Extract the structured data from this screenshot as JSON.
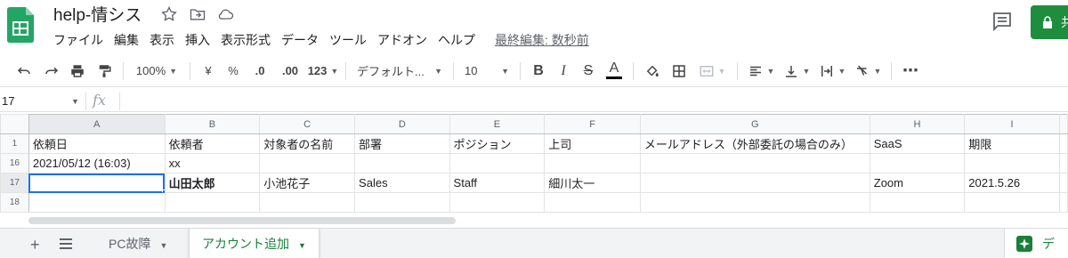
{
  "header": {
    "title": "help-情シス",
    "menu": [
      "ファイル",
      "編集",
      "表示",
      "挿入",
      "表示形式",
      "データ",
      "ツール",
      "アドオン",
      "ヘルプ"
    ],
    "last_edit": "最終編集: 数秒前",
    "share_label": "共"
  },
  "toolbar": {
    "zoom": "100%",
    "currency": "¥",
    "percent": "%",
    "decimal_dec": ".0",
    "decimal_inc": ".00",
    "format_more": "123",
    "font": "デフォルト...",
    "font_size": "10",
    "bold": "B",
    "italic": "I",
    "strike": "S",
    "text_color": "A",
    "more": "⋯"
  },
  "formula_bar": {
    "name_box": "17",
    "fx": "fx"
  },
  "grid": {
    "columns": [
      "A",
      "B",
      "C",
      "D",
      "E",
      "F",
      "G",
      "H",
      "I"
    ],
    "rows": [
      {
        "num": "1",
        "cells": [
          "依頼日",
          "依頼者",
          "対象者の名前",
          "部署",
          "ポジション",
          "上司",
          "メールアドレス（外部委託の場合のみ）",
          "SaaS",
          "期限"
        ]
      },
      {
        "num": "16",
        "cells": [
          "2021/05/12 (16:03)",
          "xx",
          "",
          "",
          "",
          "",
          "",
          "",
          ""
        ]
      },
      {
        "num": "17",
        "cells": [
          "",
          "山田太郎",
          "小池花子",
          "Sales",
          "Staff",
          "細川太一",
          "",
          "Zoom",
          "2021.5.26"
        ]
      },
      {
        "num": "18",
        "cells": [
          "",
          "",
          "",
          "",
          "",
          "",
          "",
          "",
          ""
        ]
      }
    ]
  },
  "sheets": {
    "tab1": "PC故障",
    "tab2": "アカウント追加",
    "explore": "デ"
  },
  "colors": {
    "accent": "#1a73e8",
    "brand_green": "#188038",
    "share_green": "#1e8e3e"
  }
}
